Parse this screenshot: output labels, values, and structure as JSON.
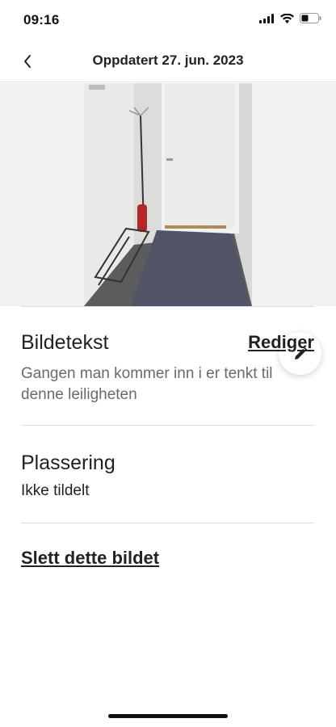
{
  "status_bar": {
    "time": "09:16",
    "icons": [
      "signal-icon",
      "wifi-icon",
      "battery-icon"
    ]
  },
  "nav": {
    "back_icon": "chevron-left-icon",
    "title": "Oppdatert 27. jun. 2023"
  },
  "photo": {
    "description_icon": "hallway-photo",
    "edit_icon": "pencil-icon"
  },
  "caption": {
    "heading": "Bildetekst",
    "edit_label": "Rediger",
    "text": "Gangen man kommer inn i er tenkt til denne leiligheten"
  },
  "location": {
    "heading": "Plassering",
    "value": "Ikke tildelt"
  },
  "actions": {
    "delete_label": "Slett dette bildet"
  }
}
